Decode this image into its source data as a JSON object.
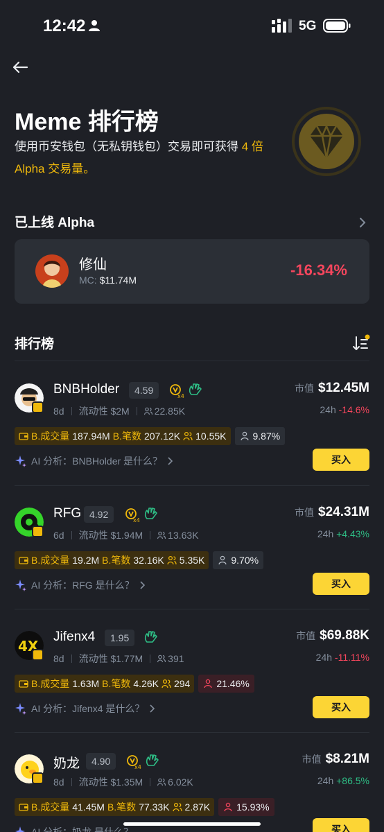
{
  "status": {
    "time": "12:42",
    "network": "5G"
  },
  "header": {
    "title": "Meme 排行榜",
    "subtitle_pre": "使用币安钱包（无私钥钱包）交易即可获得",
    "subtitle_hl": "4 倍 Alpha 交易量。"
  },
  "listed": {
    "section_title": "已上线 Alpha",
    "name": "修仙",
    "mc_label": "MC:",
    "mc_value": "$11.74M",
    "change": "-16.34%"
  },
  "ranking": {
    "section_title": "排行榜",
    "mcap_label": "市值",
    "h24_label": "24h",
    "liq_label": "流动性",
    "vol_label": "B.成交量",
    "tx_label": "B.笔数",
    "ai_prefix": "AI 分析：",
    "ai_suffix": "是什么？",
    "buy_label": "买入",
    "items": [
      {
        "name": "BNBHolder",
        "score": "4.59",
        "age": "8d",
        "liquidity": "$2M",
        "holders": "22.85K",
        "mcap": "$12.45M",
        "change": "-14.6%",
        "vol": "187.94M",
        "tx": "207.12K",
        "traders": "10.55K",
        "top_pct": "9.87%",
        "ai_name": "BNBHolder"
      },
      {
        "name": "RFG",
        "score": "4.92",
        "age": "6d",
        "liquidity": "$1.94M",
        "holders": "13.63K",
        "mcap": "$24.31M",
        "change": "+4.43%",
        "vol": "19.2M",
        "tx": "32.16K",
        "traders": "5.35K",
        "top_pct": "9.70%",
        "ai_name": "RFG"
      },
      {
        "name": "Jifenx4",
        "score": "1.95",
        "age": "8d",
        "liquidity": "$1.77M",
        "holders": "391",
        "mcap": "$69.88K",
        "change": "-11.11%",
        "vol": "1.63M",
        "tx": "4.26K",
        "traders": "294",
        "top_pct": "21.46%",
        "ai_name": "Jifenx4"
      },
      {
        "name": "奶龙",
        "score": "4.90",
        "age": "8d",
        "liquidity": "$1.35M",
        "holders": "6.02K",
        "mcap": "$8.21M",
        "change": "+86.5%",
        "vol": "41.45M",
        "tx": "77.33K",
        "traders": "2.87K",
        "top_pct": "15.93%",
        "ai_name": "奶龙"
      }
    ]
  },
  "colors": {
    "accent": "#f0b90b",
    "up": "#2ebd85",
    "down": "#f6465d",
    "bg": "#1e2026",
    "card": "#2b2f36"
  },
  "icons": [
    "person-icon",
    "signal-icon",
    "battery-icon",
    "back-arrow-icon",
    "diamond-badge-icon",
    "chevron-right-icon",
    "sort-icon",
    "wallet-icon",
    "people-icon",
    "sparkle-icon",
    "wave-hand-icon",
    "vx4-icon"
  ]
}
